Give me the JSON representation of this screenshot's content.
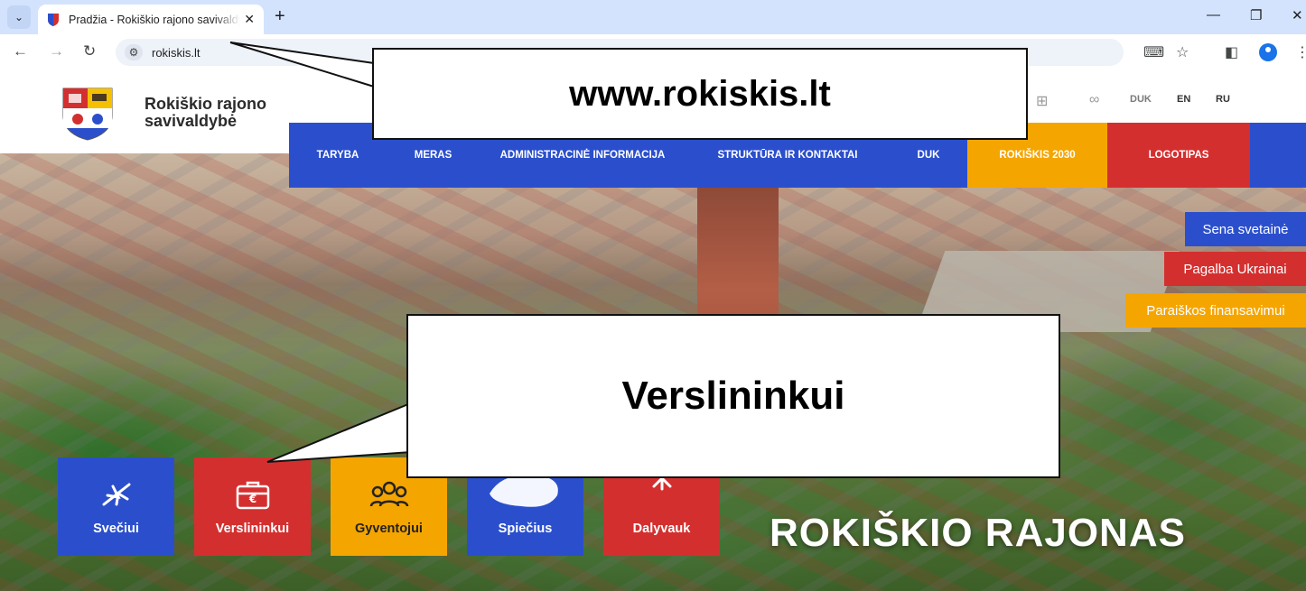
{
  "browser": {
    "tab_title": "Pradžia - Rokiškio rajono savivaldybė",
    "close_tab": "✕",
    "new_tab": "+",
    "url": "rokiskis.lt",
    "window": {
      "minimize": "—",
      "restore": "❐",
      "close": "✕"
    },
    "nav": {
      "back": "←",
      "forward": "→",
      "reload": "↻"
    },
    "icons": {
      "translate": "⌨",
      "bookmark": "☆",
      "sidebar": "◧",
      "menu": "⋮",
      "tab_search": "⌄"
    }
  },
  "header": {
    "brand_line1": "Rokiškio rajono",
    "brand_line2": "savivaldybė",
    "util": {
      "faq": "DUK",
      "en": "EN",
      "ru": "RU",
      "sitemap_icon": "sitemap-icon",
      "accessibility_icon": "glasses-icon"
    }
  },
  "nav": {
    "items": [
      {
        "label": "TARYBA",
        "color": "#2b4fcc"
      },
      {
        "label": "MERAS",
        "color": "#2b4fcc"
      },
      {
        "label": "ADMINISTRACINĖ INFORMACIJA",
        "color": "#2b4fcc"
      },
      {
        "label": "STRUKTŪRA IR KONTAKTAI",
        "color": "#2b4fcc"
      },
      {
        "label": "DUK",
        "color": "#2b4fcc"
      },
      {
        "label": "ROKIŠKIS 2030",
        "color": "#f5a500"
      },
      {
        "label": "LOGOTIPAS",
        "color": "#d42f2f"
      },
      {
        "label": "",
        "color": "#2b4fcc"
      }
    ]
  },
  "side_buttons": {
    "old_site": "Sena svetainė",
    "ukraine": "Pagalba Ukrainai",
    "funding": "Paraiškos finansavimui"
  },
  "tiles": [
    {
      "label": "Svečiui",
      "color": "#2b4fcc",
      "icon": "airplane-icon"
    },
    {
      "label": "Verslininkui",
      "color": "#d42f2f",
      "icon": "briefcase-euro-icon"
    },
    {
      "label": "Gyventojui",
      "color": "#f5a500",
      "icon": "people-icon"
    },
    {
      "label": "Spiečius",
      "color": "#2b4fcc",
      "icon": "swarm-icon"
    },
    {
      "label": "Dalyvauk",
      "color": "#d42f2f",
      "icon": "participate-icon"
    }
  ],
  "hero_title": "ROKIŠKIO RAJONAS",
  "callouts": {
    "url_callout": "www.rokiskis.lt",
    "button_callout": "Verslininkui"
  },
  "colors": {
    "blue": "#2b4fcc",
    "red": "#d42f2f",
    "orange": "#f5a500"
  }
}
